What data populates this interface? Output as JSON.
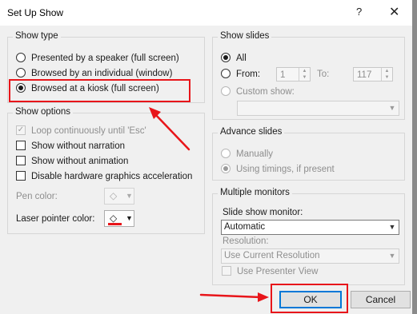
{
  "window": {
    "title": "Set Up Show",
    "help_glyph": "?",
    "close_glyph": "✕"
  },
  "show_type": {
    "legend": "Show type",
    "options": [
      {
        "label": "Presented by a speaker (full screen)",
        "selected": false
      },
      {
        "label": "Browsed by an individual (window)",
        "selected": false
      },
      {
        "label": "Browsed at a kiosk (full screen)",
        "selected": true
      }
    ]
  },
  "show_options": {
    "legend": "Show options",
    "checkboxes": [
      {
        "label": "Loop continuously until 'Esc'",
        "checked": true,
        "enabled": false
      },
      {
        "label": "Show without narration",
        "checked": false,
        "enabled": true
      },
      {
        "label": "Show without animation",
        "checked": false,
        "enabled": true
      },
      {
        "label": "Disable hardware graphics acceleration",
        "checked": false,
        "enabled": true
      }
    ],
    "pen_color_label": "Pen color:",
    "laser_color_label": "Laser pointer color:",
    "laser_color": "#e8151a"
  },
  "show_slides": {
    "legend": "Show slides",
    "all_label": "All",
    "from_label": "From:",
    "from_value": "1",
    "to_label": "To:",
    "to_value": "117",
    "custom_label": "Custom show:"
  },
  "advance_slides": {
    "legend": "Advance slides",
    "manually_label": "Manually",
    "timings_label": "Using timings, if present"
  },
  "multiple_monitors": {
    "legend": "Multiple monitors",
    "monitor_label": "Slide show monitor:",
    "monitor_value": "Automatic",
    "resolution_label": "Resolution:",
    "resolution_value": "Use Current Resolution",
    "presenter_view_label": "Use Presenter View"
  },
  "buttons": {
    "ok": "OK",
    "cancel": "Cancel"
  },
  "colors": {
    "annotation_red": "#e8151a",
    "accent": "#0078d7"
  }
}
